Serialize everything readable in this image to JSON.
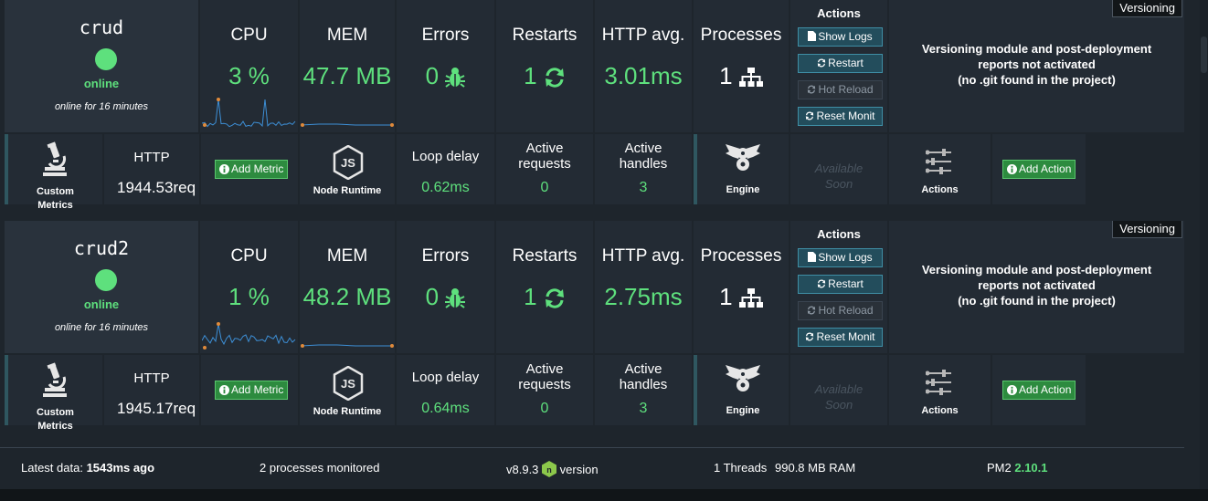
{
  "processes": [
    {
      "name": "crud",
      "status": "online",
      "uptime": "online for 16 minutes",
      "cpu": {
        "title": "CPU",
        "value": "3 %"
      },
      "mem": {
        "title": "MEM",
        "value": "47.7 MB"
      },
      "errors": {
        "title": "Errors",
        "value": "0"
      },
      "restarts": {
        "title": "Restarts",
        "value": "1"
      },
      "http_avg": {
        "title": "HTTP avg.",
        "value": "3.01ms"
      },
      "processes": {
        "title": "Processes",
        "value": "1"
      },
      "actions": {
        "title": "Actions",
        "show_logs": "Show Logs",
        "restart": "Restart",
        "hot_reload": "Hot Reload",
        "reset_monit": "Reset Monit"
      },
      "versioning": {
        "badge": "Versioning",
        "line1": "Versioning module and post-deployment",
        "line2": "reports not activated",
        "line3": "(no .git found in the project)"
      },
      "custom_metrics": {
        "line1": "Custom",
        "line2": "Metrics"
      },
      "http": {
        "title": "HTTP",
        "value": "1944.53req"
      },
      "add_metric": "Add Metric",
      "node_runtime": "Node Runtime",
      "loop_delay": {
        "title": "Loop delay",
        "value": "0.62ms"
      },
      "active_requests": {
        "line1": "Active",
        "line2": "requests",
        "value": "0"
      },
      "active_handles": {
        "line1": "Active",
        "line2": "handles",
        "value": "3"
      },
      "engine": "Engine",
      "available_soon": {
        "line1": "Available",
        "line2": "Soon"
      },
      "actions_label": "Actions",
      "add_action": "Add Action"
    },
    {
      "name": "crud2",
      "status": "online",
      "uptime": "online for 16 minutes",
      "cpu": {
        "title": "CPU",
        "value": "1 %"
      },
      "mem": {
        "title": "MEM",
        "value": "48.2 MB"
      },
      "errors": {
        "title": "Errors",
        "value": "0"
      },
      "restarts": {
        "title": "Restarts",
        "value": "1"
      },
      "http_avg": {
        "title": "HTTP avg.",
        "value": "2.75ms"
      },
      "processes": {
        "title": "Processes",
        "value": "1"
      },
      "actions": {
        "title": "Actions",
        "show_logs": "Show Logs",
        "restart": "Restart",
        "hot_reload": "Hot Reload",
        "reset_monit": "Reset Monit"
      },
      "versioning": {
        "badge": "Versioning",
        "line1": "Versioning module and post-deployment",
        "line2": "reports not activated",
        "line3": "(no .git found in the project)"
      },
      "custom_metrics": {
        "line1": "Custom",
        "line2": "Metrics"
      },
      "http": {
        "title": "HTTP",
        "value": "1945.17req"
      },
      "add_metric": "Add Metric",
      "node_runtime": "Node Runtime",
      "loop_delay": {
        "title": "Loop delay",
        "value": "0.64ms"
      },
      "active_requests": {
        "line1": "Active",
        "line2": "requests",
        "value": "0"
      },
      "active_handles": {
        "line1": "Active",
        "line2": "handles",
        "value": "3"
      },
      "engine": "Engine",
      "available_soon": {
        "line1": "Available",
        "line2": "Soon"
      },
      "actions_label": "Actions",
      "add_action": "Add Action"
    }
  ],
  "footer": {
    "latest_label": "Latest data:",
    "latest_value": "1543ms ago",
    "processes_monitored": "2 processes monitored",
    "node_version": "v8.9.3",
    "version_label": "version",
    "threads": "1 Threads",
    "ram": "990.8 MB RAM",
    "pm2_label": "PM2",
    "pm2_version": "2.10.1"
  },
  "colors": {
    "accent_green": "#5ee07d",
    "button_blue": "#234d5c",
    "background": "#1e252c",
    "cell": "#232b34"
  }
}
